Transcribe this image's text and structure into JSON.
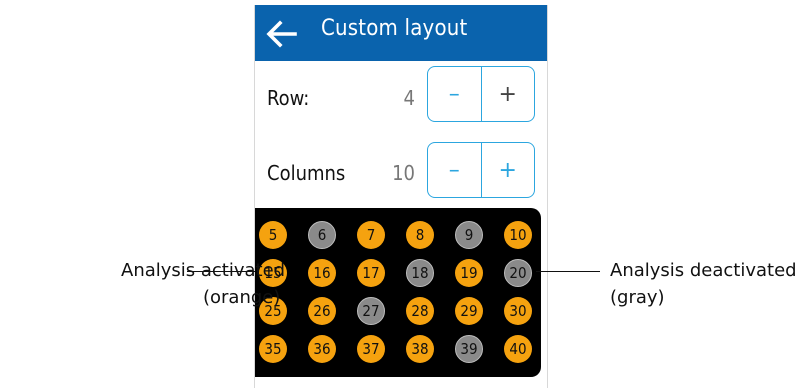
{
  "header": {
    "title": "Custom layout"
  },
  "settings": {
    "row": {
      "label": "Row:",
      "value": "4",
      "minus": "–",
      "plus": "+"
    },
    "columns": {
      "label": "Columns",
      "value": "10",
      "minus": "–",
      "plus": "+"
    }
  },
  "grid": {
    "rows": [
      [
        {
          "n": "5",
          "active": true
        },
        {
          "n": "6",
          "active": false
        },
        {
          "n": "7",
          "active": true
        },
        {
          "n": "8",
          "active": true
        },
        {
          "n": "9",
          "active": false
        },
        {
          "n": "10",
          "active": true
        }
      ],
      [
        {
          "n": "15",
          "active": true
        },
        {
          "n": "16",
          "active": true
        },
        {
          "n": "17",
          "active": true
        },
        {
          "n": "18",
          "active": false
        },
        {
          "n": "19",
          "active": true
        },
        {
          "n": "20",
          "active": false
        }
      ],
      [
        {
          "n": "25",
          "active": true
        },
        {
          "n": "26",
          "active": true
        },
        {
          "n": "27",
          "active": false
        },
        {
          "n": "28",
          "active": true
        },
        {
          "n": "29",
          "active": true
        },
        {
          "n": "30",
          "active": true
        }
      ],
      [
        {
          "n": "35",
          "active": true
        },
        {
          "n": "36",
          "active": true
        },
        {
          "n": "37",
          "active": true
        },
        {
          "n": "38",
          "active": true
        },
        {
          "n": "39",
          "active": false
        },
        {
          "n": "40",
          "active": true
        }
      ]
    ]
  },
  "callouts": {
    "left_line1": "Analysis activated",
    "left_line2": "(orange)",
    "right_line1": "Analysis deactivated",
    "right_line2": "(gray)"
  },
  "colors": {
    "header": "#0a63ad",
    "accent": "#2ca6df",
    "activated": "#f5a20f",
    "deactivated": "#8a8a8a",
    "grid_bg": "#000000"
  },
  "icons": {
    "back": "back-arrow-icon"
  }
}
